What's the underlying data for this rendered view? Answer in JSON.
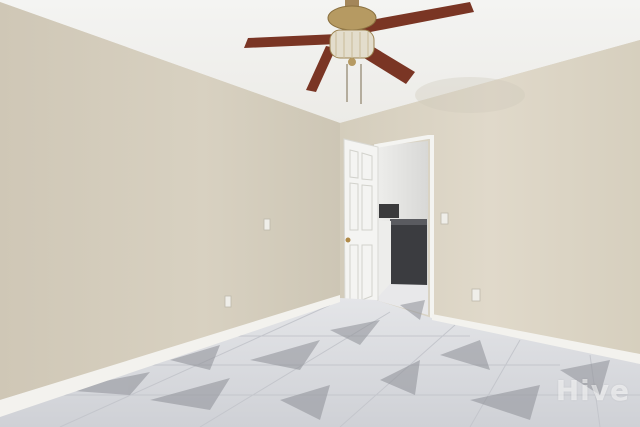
{
  "watermark": {
    "text": "Hive"
  },
  "colors": {
    "ceiling": "#f1f1ef",
    "left_wall": "#d6cfbf",
    "right_wall": "#ddd6c6",
    "baseboard": "#f3f2ee",
    "door": "#f4f4f2",
    "floor_base": "#d9dbe0",
    "floor_vein": "#8e9097",
    "fan_blade": "#7a3524",
    "fan_brass": "#b69a62"
  },
  "icons": [
    "ceiling-fan-icon",
    "outlet-icon",
    "light-switch-icon"
  ]
}
